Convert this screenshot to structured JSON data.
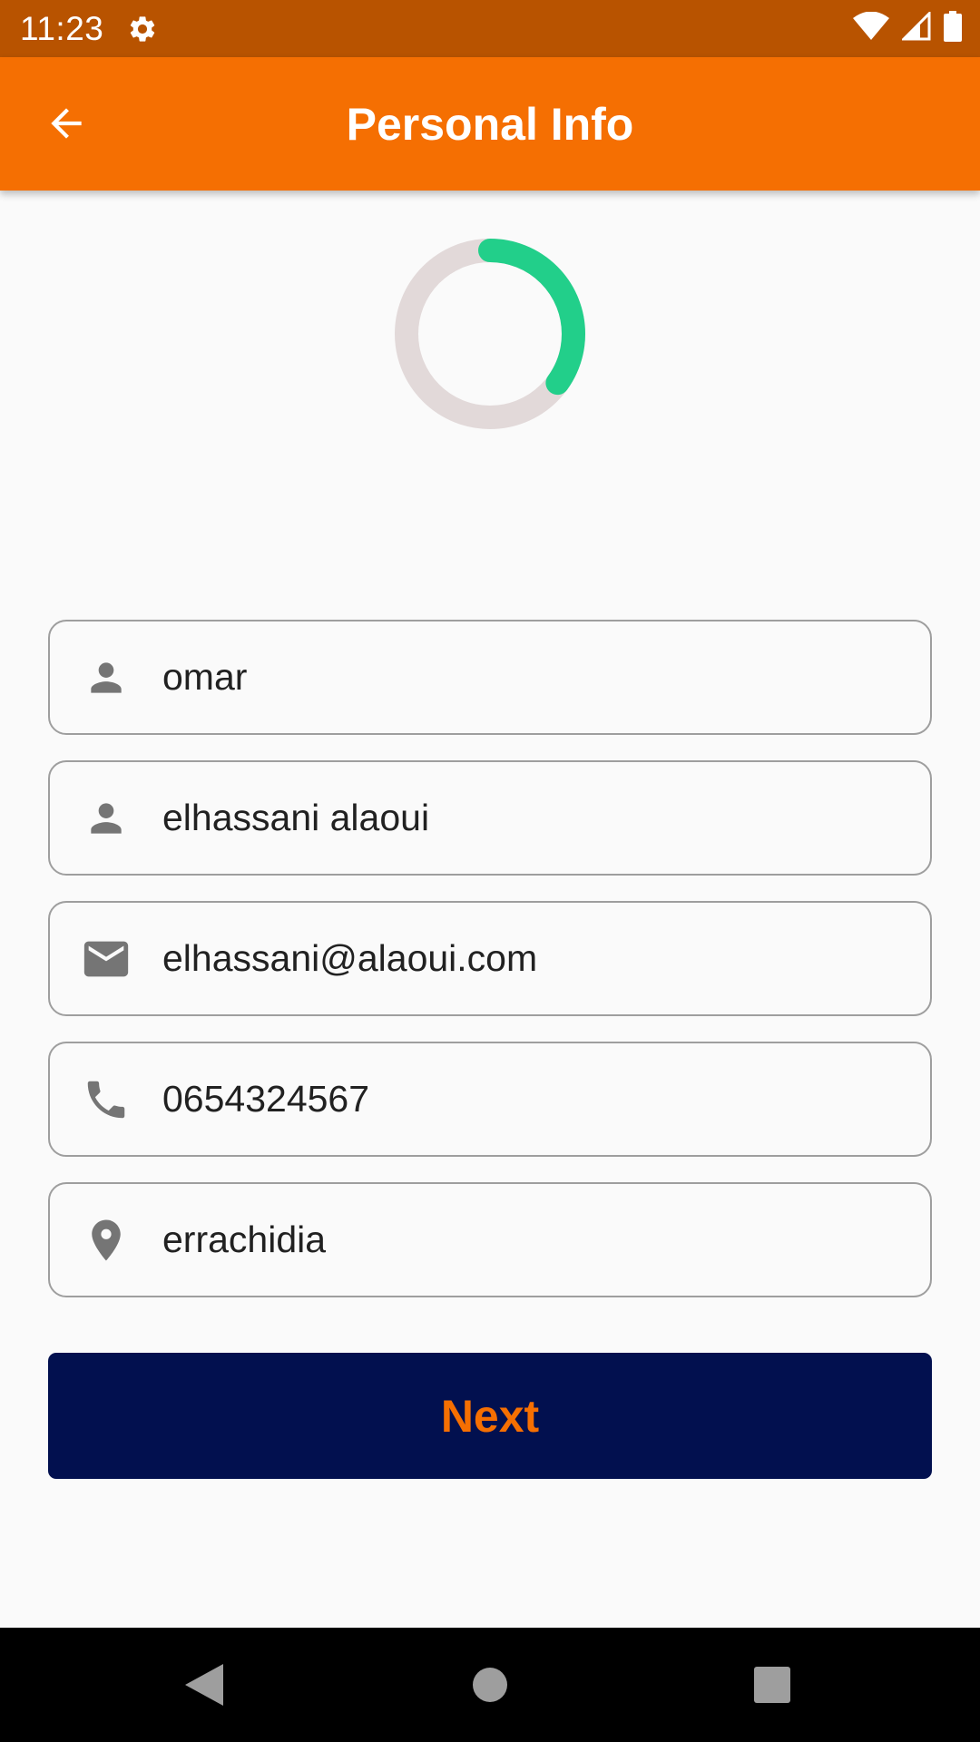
{
  "status_bar": {
    "time": "11:23",
    "icons": [
      "settings-icon",
      "wifi-icon",
      "signal-icon",
      "battery-icon"
    ]
  },
  "app_bar": {
    "title": "Personal Info",
    "back_icon": "arrow-back-icon",
    "background_color": "#f56f02"
  },
  "progress": {
    "fraction": 0.35,
    "track_color": "#e2d9d9",
    "fill_color": "#22cf8a"
  },
  "form": {
    "fields": [
      {
        "icon": "person-icon",
        "value": "omar"
      },
      {
        "icon": "person-icon",
        "value": "elhassani alaoui"
      },
      {
        "icon": "email-icon",
        "value": "elhassani@alaoui.com"
      },
      {
        "icon": "phone-icon",
        "value": "0654324567"
      },
      {
        "icon": "location-icon",
        "value": "errachidia"
      }
    ]
  },
  "next_button": {
    "label": "Next",
    "background_color": "#02104f",
    "text_color": "#f56f02"
  },
  "nav_bar": {
    "buttons": [
      "back-triangle-icon",
      "home-circle-icon",
      "recents-square-icon"
    ]
  }
}
